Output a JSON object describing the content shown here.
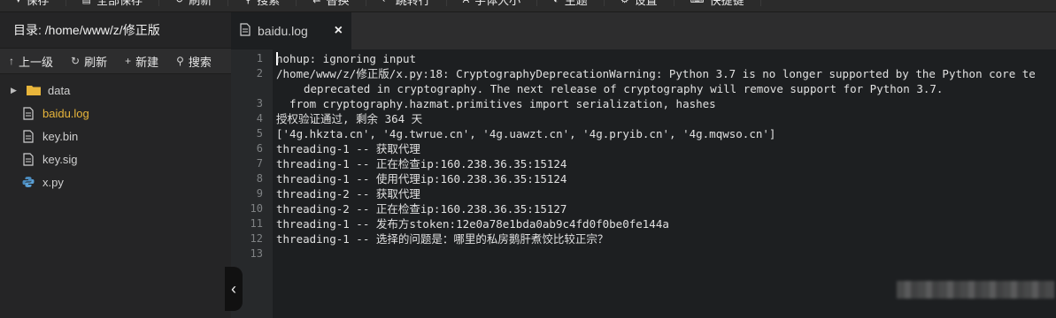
{
  "toolbar": {
    "items": [
      {
        "icon": "chevron-down-icon",
        "label": "保存"
      },
      {
        "icon": "save-all-icon",
        "label": "全部保存"
      },
      {
        "icon": "refresh-icon",
        "label": "刷新"
      },
      {
        "icon": "search-icon",
        "label": "搜索"
      },
      {
        "icon": "replace-icon",
        "label": "替换"
      },
      {
        "icon": "goto-line-icon",
        "label": "跳转行"
      },
      {
        "icon": "font-icon",
        "label": "字体大小"
      },
      {
        "icon": "theme-icon",
        "label": "主题"
      },
      {
        "icon": "gear-icon",
        "label": "设置"
      },
      {
        "icon": "keyboard-icon",
        "label": "快捷键"
      }
    ]
  },
  "sidebar": {
    "dir_label": "目录: /home/www/z/修正版",
    "actions": {
      "up": "上一级",
      "refresh": "刷新",
      "new": "新建",
      "search": "搜索"
    },
    "tree": [
      {
        "type": "folder",
        "name": "data"
      },
      {
        "type": "file",
        "name": "baidu.log",
        "active": true
      },
      {
        "type": "file",
        "name": "key.bin"
      },
      {
        "type": "file",
        "name": "key.sig"
      },
      {
        "type": "python",
        "name": "x.py"
      }
    ]
  },
  "editor": {
    "tab_title": "baidu.log",
    "lines": [
      {
        "n": "1",
        "text": "nohup: ignoring input"
      },
      {
        "n": "2",
        "text": "/home/www/z/修正版/x.py:18: CryptographyDeprecationWarning: Python 3.7 is no longer supported by the Python core te",
        "cont": "deprecated in cryptography. The next release of cryptography will remove support for Python 3.7."
      },
      {
        "n": "3",
        "text": "  from cryptography.hazmat.primitives import serialization, hashes"
      },
      {
        "n": "4",
        "text": "授权验证通过, 剩余 364 天"
      },
      {
        "n": "5",
        "text": "['4g.hkzta.cn', '4g.twrue.cn', '4g.uawzt.cn', '4g.pryib.cn', '4g.mqwso.cn']"
      },
      {
        "n": "6",
        "text": "threading-1 -- 获取代理"
      },
      {
        "n": "7",
        "text": "threading-1 -- 正在检查ip:160.238.36.35:15124"
      },
      {
        "n": "8",
        "text": "threading-1 -- 使用代理ip:160.238.36.35:15124"
      },
      {
        "n": "9",
        "text": "threading-2 -- 获取代理"
      },
      {
        "n": "10",
        "text": "threading-2 -- 正在检查ip:160.238.36.35:15127"
      },
      {
        "n": "11",
        "text": "threading-1 -- 发布方stoken:12e0a78e1bda0ab9c4fd0f0be0fe144a"
      },
      {
        "n": "12",
        "text": "threading-1 -- 选择的问题是：哪里的私房鹅肝煮饺比较正宗？"
      },
      {
        "n": "13",
        "text": ""
      }
    ]
  }
}
